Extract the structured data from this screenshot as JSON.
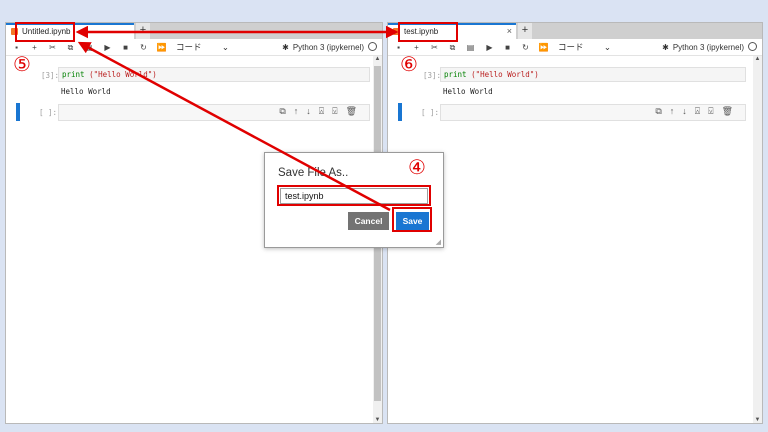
{
  "colors": {
    "background": "#dae3f3",
    "accent": "#1976d2",
    "annotation": "#e00000"
  },
  "left_notebook": {
    "tab_title": "Untitled.ipynb",
    "cell_type": "コード",
    "kernel": "Python 3 (ipykernel)",
    "cell1": {
      "prompt": "[3]:",
      "code_fn": "print",
      "code_args": "(\"Hello World\")",
      "output": "Hello World"
    },
    "cell2": {
      "prompt": "[ ]:"
    },
    "annotation": "⑤"
  },
  "right_notebook": {
    "tab_title": "test.ipynb",
    "tab_close": "×",
    "tab_add": "+",
    "cell_type": "コード",
    "kernel": "Python 3 (ipykernel)",
    "cell1": {
      "prompt": "[3]:",
      "code_fn": "print",
      "code_args": "(\"Hello World\")",
      "output": "Hello World"
    },
    "cell2": {
      "prompt": "[ ]:"
    },
    "annotation": "⑥"
  },
  "dialog": {
    "title": "Save File As..",
    "filename": "test.ipynb",
    "cancel_label": "Cancel",
    "save_label": "Save",
    "annotation": "④"
  },
  "toolbar_icons": [
    "save-icon",
    "add-cell-icon",
    "cut-icon",
    "copy-icon",
    "paste-icon",
    "run-icon",
    "stop-icon",
    "restart-icon",
    "fast-forward-icon"
  ],
  "cell_tool_icons": [
    "duplicate-icon",
    "move-up-icon",
    "move-down-icon",
    "insert-above-icon",
    "insert-below-icon",
    "delete-icon"
  ]
}
